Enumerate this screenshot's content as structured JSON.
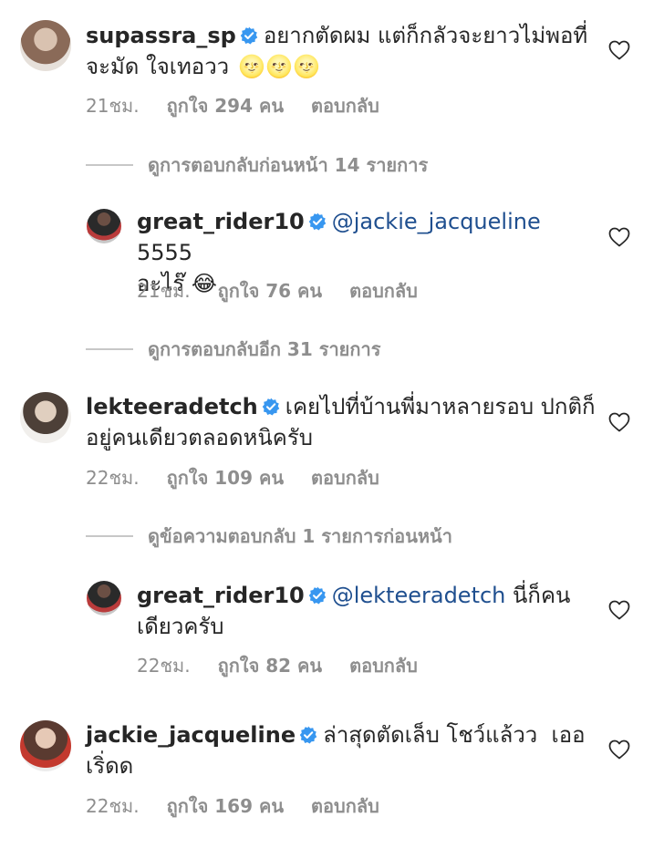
{
  "comments": [
    {
      "username": "supassra_sp",
      "text_line1": "อยากตัดผม แต่ก็กลัวจะยาวไม่พอที่",
      "text_line2": "จะมัด ใจเทอวว",
      "emoji": "🌝🌝🌝",
      "time": "21ชม.",
      "likes": "ถูกใจ 294 คน",
      "reply": "ตอบกลับ"
    },
    {
      "username": "great_rider10",
      "mention": "@jackie_jacqueline",
      "text_line1_rest": " 5555",
      "text_line2": "อะไร๊ 😂",
      "time": "21ชม.",
      "likes": "ถูกใจ 76 คน",
      "reply": "ตอบกลับ"
    },
    {
      "username": "lekteeradetch",
      "text_line1": "เคยไปที่บ้านพี่มาหลายรอบ ปกติก็",
      "text_line2": "อยู่คนเดียวตลอดหนิครับ",
      "time": "22ชม.",
      "likes": "ถูกใจ 109 คน",
      "reply": "ตอบกลับ"
    },
    {
      "username": "great_rider10",
      "mention": "@lekteeradetch",
      "text_line1_rest": " นี่ก็คน",
      "text_line2": "เดียวครับ",
      "time": "22ชม.",
      "likes": "ถูกใจ 82 คน",
      "reply": "ตอบกลับ"
    },
    {
      "username": "jackie_jacqueline",
      "text_line1": "ล่าสุดตัดเล็บ โชว์แล้วว  เออ",
      "text_line2": "เริ่ดด",
      "time": "22ชม.",
      "likes": "ถูกใจ 169 คน",
      "reply": "ตอบกลับ"
    }
  ],
  "threads": [
    "ดูการตอบกลับก่อนหน้า 14 รายการ",
    "ดูการตอบกลับอีก 31 รายการ",
    "ดูข้อความตอบกลับ 1 รายการก่อนหน้า"
  ],
  "colors": {
    "verified": "#3897f0",
    "mention": "#1f4f8f",
    "meta": "#8e8e8e",
    "text": "#262626"
  },
  "icons": {
    "verified": "verified-badge-icon",
    "like": "heart-icon"
  }
}
